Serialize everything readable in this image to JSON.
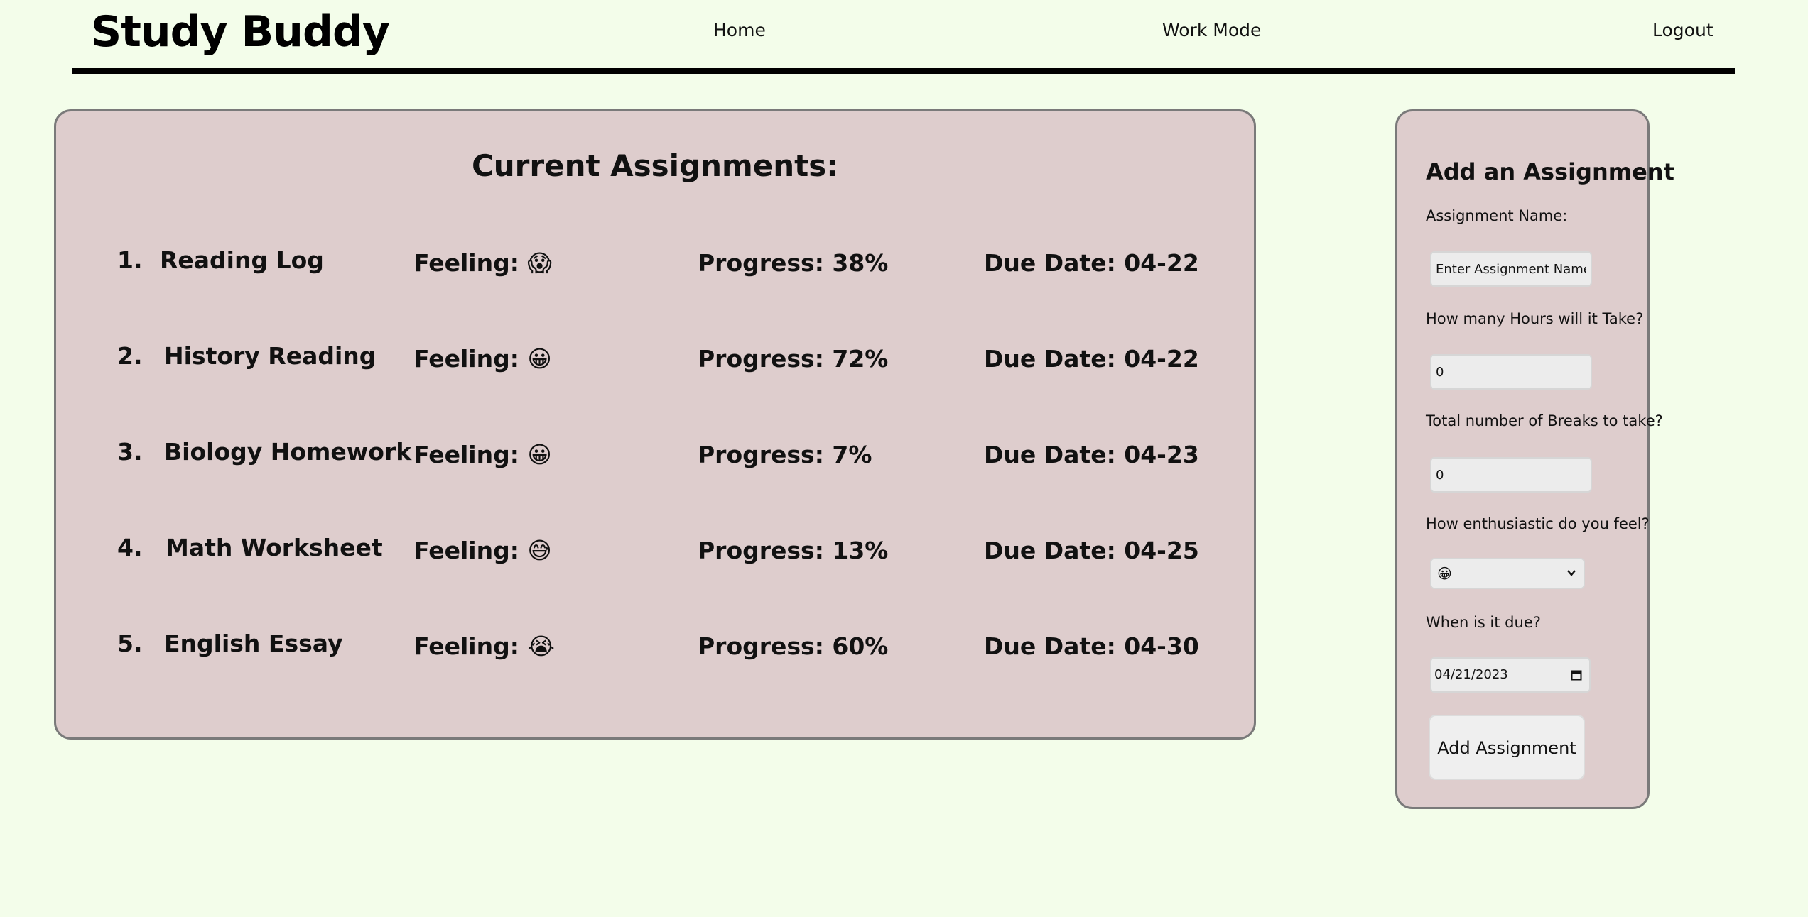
{
  "header": {
    "brand": "Study Buddy",
    "nav": {
      "home": "Home",
      "work_mode": "Work Mode",
      "logout": "Logout"
    }
  },
  "assignments": {
    "title": "Current Assignments:",
    "items": [
      {
        "number": "1.",
        "name": "Reading Log",
        "feeling_label": "Feeling:",
        "feeling_emoji": "😱",
        "progress": "Progress: 38%",
        "progress_value": 38,
        "due": "Due Date: 04-22"
      },
      {
        "number": "2.",
        "name": "History Reading",
        "feeling_label": "Feeling:",
        "feeling_emoji": "😀",
        "progress": "Progress: 72%",
        "progress_value": 72,
        "due": "Due Date: 04-22"
      },
      {
        "number": "3.",
        "name": "Biology Homework",
        "feeling_label": "Feeling:",
        "feeling_emoji": "😀",
        "progress": "Progress: 7%",
        "progress_value": 7,
        "due": "Due Date: 04-23"
      },
      {
        "number": "4.",
        "name": "Math Worksheet",
        "feeling_label": "Feeling:",
        "feeling_emoji": "😅",
        "progress": "Progress: 13%",
        "progress_value": 13,
        "due": "Due Date: 04-25"
      },
      {
        "number": "5.",
        "name": "English Essay",
        "feeling_label": "Feeling:",
        "feeling_emoji": "😭",
        "progress": "Progress: 60%",
        "progress_value": 60,
        "due": "Due Date: 04-30"
      }
    ]
  },
  "add_form": {
    "title": "Add an Assignment",
    "name_label": "Assignment Name:",
    "name_placeholder": "Enter Assignment Name",
    "hours_label": "How many Hours will it Take?",
    "hours_value": "0",
    "breaks_label": "Total number of Breaks to take?",
    "breaks_value": "0",
    "enthusiasm_label": "How enthusiastic do you feel?",
    "enthusiasm_selected": "😀",
    "due_label": "When is it due?",
    "due_value": "04/21/2023",
    "submit_label": "Add Assignment"
  },
  "icons": {
    "dropdown": "chevron-down-icon",
    "date": "calendar-icon"
  },
  "colors": {
    "background": "#f3fdea",
    "panel": "#decdcd",
    "panel_border": "#7a7a7a",
    "header_rule": "#000000"
  }
}
